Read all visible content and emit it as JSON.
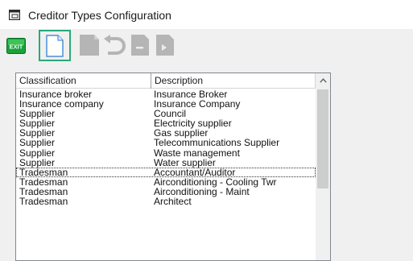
{
  "window": {
    "title": "Creditor Types Configuration"
  },
  "toolbar": {
    "exit_label": "EXIT",
    "buttons": [
      "exit",
      "new",
      "save",
      "undo",
      "delete",
      "print"
    ]
  },
  "list": {
    "columns": [
      "Classification",
      "Description"
    ],
    "rows": [
      {
        "classification": "Insurance broker",
        "description": "Insurance Broker"
      },
      {
        "classification": "Insurance company",
        "description": "Insurance Company"
      },
      {
        "classification": "Supplier",
        "description": "Council"
      },
      {
        "classification": "Supplier",
        "description": "Electricity supplier"
      },
      {
        "classification": "Supplier",
        "description": "Gas supplier"
      },
      {
        "classification": "Supplier",
        "description": "Telecommunications Supplier"
      },
      {
        "classification": "Supplier",
        "description": "Waste management"
      },
      {
        "classification": "Supplier",
        "description": "Water supplier"
      },
      {
        "classification": "Tradesman",
        "description": "Accountant/Auditor"
      },
      {
        "classification": "Tradesman",
        "description": "Airconditioning - Cooling Twr"
      },
      {
        "classification": "Tradesman",
        "description": "Airconditioning - Maint"
      },
      {
        "classification": "Tradesman",
        "description": "Architect"
      }
    ],
    "focused_row": 8
  },
  "colors": {
    "accent_focus": "#2aa87a",
    "exit_green": "#1aa23a",
    "disabled_icon": "#b5b5b5",
    "new_doc_blue": "#4a90d9"
  }
}
